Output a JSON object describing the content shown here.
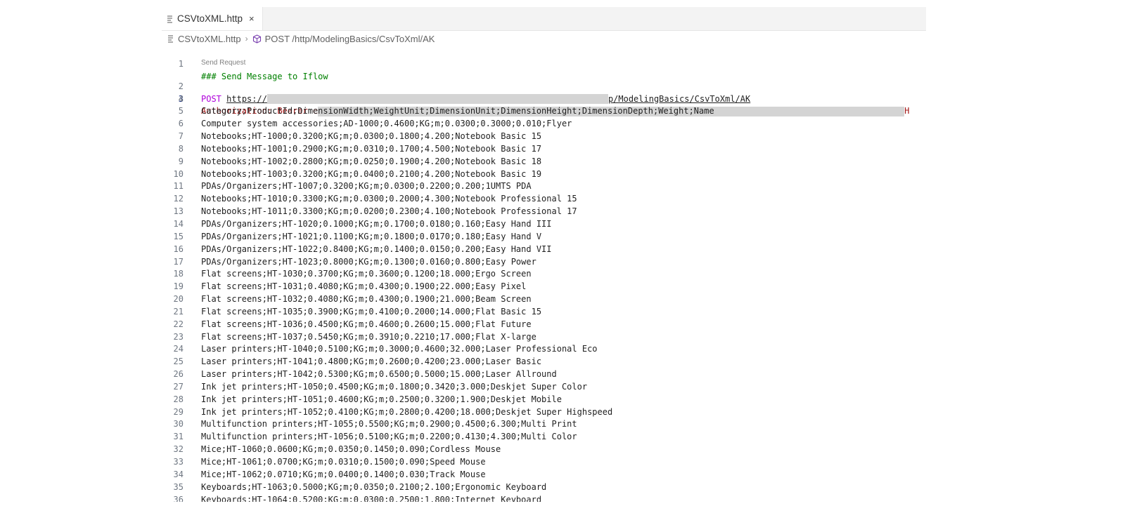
{
  "tab": {
    "label": "CSVtoXML.http",
    "close": "×"
  },
  "breadcrumb": {
    "file": "CSVtoXML.http",
    "separator": "›",
    "request": "POST /http/ModelingBasics/CsvToXml/AK"
  },
  "codelens": "Send Request",
  "line1": {
    "num": "1",
    "text": "### Send Message to Iflow"
  },
  "line2": {
    "num": "2",
    "method": "POST",
    "url_prefix": "https://",
    "url_suffix": "p/ModelingBasics/CsvToXml/AK"
  },
  "line3": {
    "num": "3",
    "header_name": "Authorization:",
    "header_val_prefix": " Bearer e",
    "header_val_suffix": "H"
  },
  "lines": [
    {
      "num": "4",
      "text": ""
    },
    {
      "num": "5",
      "text": "Category;ProductId;DimensionWidth;WeightUnit;DimensionUnit;DimensionHeight;DimensionDepth;Weight;Name"
    },
    {
      "num": "6",
      "text": "Computer system accessories;AD-1000;0.4600;KG;m;0.0300;0.3000;0.010;Flyer"
    },
    {
      "num": "7",
      "text": "Notebooks;HT-1000;0.3200;KG;m;0.0300;0.1800;4.200;Notebook Basic 15"
    },
    {
      "num": "8",
      "text": "Notebooks;HT-1001;0.2900;KG;m;0.0310;0.1700;4.500;Notebook Basic 17"
    },
    {
      "num": "9",
      "text": "Notebooks;HT-1002;0.2800;KG;m;0.0250;0.1900;4.200;Notebook Basic 18"
    },
    {
      "num": "10",
      "text": "Notebooks;HT-1003;0.3200;KG;m;0.0400;0.2100;4.200;Notebook Basic 19"
    },
    {
      "num": "11",
      "text": "PDAs/Organizers;HT-1007;0.3200;KG;m;0.0300;0.2200;0.200;1UMTS PDA"
    },
    {
      "num": "12",
      "text": "Notebooks;HT-1010;0.3300;KG;m;0.0300;0.2000;4.300;Notebook Professional 15"
    },
    {
      "num": "13",
      "text": "Notebooks;HT-1011;0.3300;KG;m;0.0200;0.2300;4.100;Notebook Professional 17"
    },
    {
      "num": "14",
      "text": "PDAs/Organizers;HT-1020;0.1000;KG;m;0.1700;0.0180;0.160;Easy Hand III"
    },
    {
      "num": "15",
      "text": "PDAs/Organizers;HT-1021;0.1100;KG;m;0.1800;0.0170;0.180;Easy Hand V"
    },
    {
      "num": "16",
      "text": "PDAs/Organizers;HT-1022;0.8400;KG;m;0.1400;0.0150;0.200;Easy Hand VII"
    },
    {
      "num": "17",
      "text": "PDAs/Organizers;HT-1023;0.8000;KG;m;0.1300;0.0160;0.800;Easy Power"
    },
    {
      "num": "18",
      "text": "Flat screens;HT-1030;0.3700;KG;m;0.3600;0.1200;18.000;Ergo Screen"
    },
    {
      "num": "19",
      "text": "Flat screens;HT-1031;0.4080;KG;m;0.4300;0.1900;22.000;Easy Pixel"
    },
    {
      "num": "20",
      "text": "Flat screens;HT-1032;0.4080;KG;m;0.4300;0.1900;21.000;Beam Screen"
    },
    {
      "num": "21",
      "text": "Flat screens;HT-1035;0.3900;KG;m;0.4100;0.2000;14.000;Flat Basic 15"
    },
    {
      "num": "22",
      "text": "Flat screens;HT-1036;0.4500;KG;m;0.4600;0.2600;15.000;Flat Future"
    },
    {
      "num": "23",
      "text": "Flat screens;HT-1037;0.5450;KG;m;0.3910;0.2210;17.000;Flat X-large"
    },
    {
      "num": "24",
      "text": "Laser printers;HT-1040;0.5100;KG;m;0.3000;0.4600;32.000;Laser Professional Eco"
    },
    {
      "num": "25",
      "text": "Laser printers;HT-1041;0.4800;KG;m;0.2600;0.4200;23.000;Laser Basic"
    },
    {
      "num": "26",
      "text": "Laser printers;HT-1042;0.5300;KG;m;0.6500;0.5000;15.000;Laser Allround"
    },
    {
      "num": "27",
      "text": "Ink jet printers;HT-1050;0.4500;KG;m;0.1800;0.3420;3.000;Deskjet Super Color"
    },
    {
      "num": "28",
      "text": "Ink jet printers;HT-1051;0.4600;KG;m;0.2500;0.3200;1.900;Deskjet Mobile"
    },
    {
      "num": "29",
      "text": "Ink jet printers;HT-1052;0.4100;KG;m;0.2800;0.4200;18.000;Deskjet Super Highspeed"
    },
    {
      "num": "30",
      "text": "Multifunction printers;HT-1055;0.5500;KG;m;0.2900;0.4500;6.300;Multi Print"
    },
    {
      "num": "31",
      "text": "Multifunction printers;HT-1056;0.5100;KG;m;0.2200;0.4130;4.300;Multi Color"
    },
    {
      "num": "32",
      "text": "Mice;HT-1060;0.0600;KG;m;0.0350;0.1450;0.090;Cordless Mouse"
    },
    {
      "num": "33",
      "text": "Mice;HT-1061;0.0700;KG;m;0.0310;0.1500;0.090;Speed Mouse"
    },
    {
      "num": "34",
      "text": "Mice;HT-1062;0.0710;KG;m;0.0400;0.1400;0.030;Track Mouse"
    },
    {
      "num": "35",
      "text": "Keyboards;HT-1063;0.5000;KG;m;0.0350;0.2100;2.100;Ergonomic Keyboard"
    },
    {
      "num": "36",
      "text": "Keyboards;HT-1064;0.5200;KG;m;0.0300;0.2500;1.800;Internet Keyboard"
    }
  ]
}
